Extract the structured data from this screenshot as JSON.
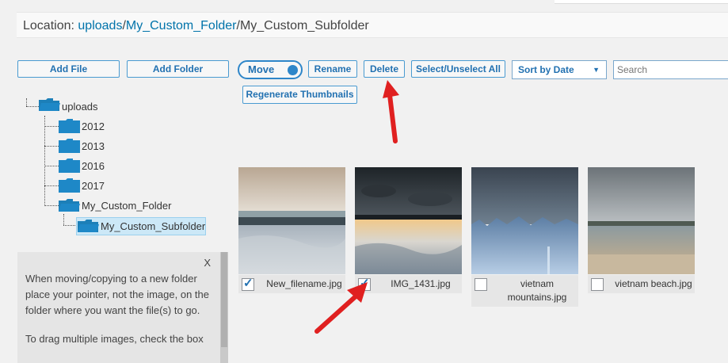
{
  "location": {
    "prefix": "Location: ",
    "crumbs": [
      "uploads",
      "My_Custom_Folder"
    ],
    "separator": "/",
    "current": "My_Custom_Subfolder"
  },
  "toolbar": {
    "add_file": "Add File",
    "add_folder": "Add Folder",
    "move": "Move",
    "rename": "Rename",
    "delete": "Delete",
    "select_all": "Select/Unselect All",
    "sort_value": "Sort by Date",
    "search_placeholder": "Search",
    "regenerate": "Regenerate Thumbnails"
  },
  "tree": {
    "root": "uploads",
    "items": [
      "2012",
      "2013",
      "2016",
      "2017",
      "My_Custom_Folder",
      "My_Custom_Subfolder"
    ],
    "selected": "My_Custom_Subfolder"
  },
  "help": {
    "close": "X",
    "paragraphs": [
      "When moving/copying to a new folder place your pointer, not the image, on the folder where you want the file(s) to go.",
      "To drag multiple images, check the box"
    ]
  },
  "files": [
    {
      "name": "New_filename.jpg",
      "checked": true
    },
    {
      "name": "IMG_1431.jpg",
      "checked": true
    },
    {
      "name": "vietnam mountains.jpg",
      "checked": false
    },
    {
      "name": "vietnam beach.jpg",
      "checked": false
    }
  ],
  "colors": {
    "accent": "#2271b1",
    "folder": "#1e88c7",
    "arrow": "#e02020"
  }
}
